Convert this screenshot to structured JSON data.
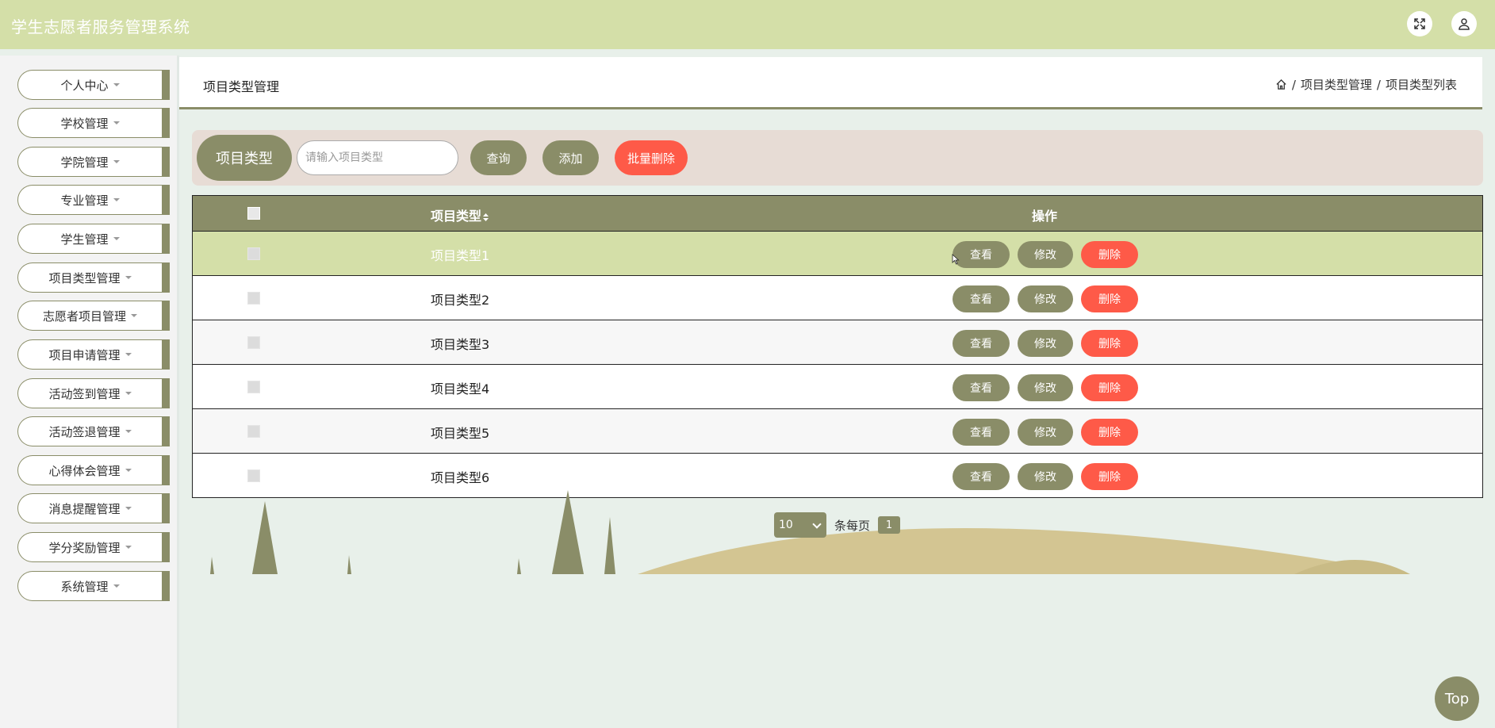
{
  "app": {
    "title": "学生志愿者服务管理系统"
  },
  "header": {
    "fullscreen_icon": "expand-icon",
    "user_icon": "user-icon"
  },
  "sidebar": {
    "items": [
      {
        "label": "个人中心"
      },
      {
        "label": "学校管理"
      },
      {
        "label": "学院管理"
      },
      {
        "label": "专业管理"
      },
      {
        "label": "学生管理"
      },
      {
        "label": "项目类型管理"
      },
      {
        "label": "志愿者项目管理"
      },
      {
        "label": "项目申请管理"
      },
      {
        "label": "活动签到管理"
      },
      {
        "label": "活动签退管理"
      },
      {
        "label": "心得体会管理"
      },
      {
        "label": "消息提醒管理"
      },
      {
        "label": "学分奖励管理"
      },
      {
        "label": "系统管理"
      }
    ]
  },
  "page": {
    "title": "项目类型管理",
    "breadcrumb": [
      "项目类型管理",
      "项目类型列表"
    ]
  },
  "search": {
    "label": "项目类型",
    "placeholder": "请输入项目类型",
    "query_label": "查询",
    "add_label": "添加",
    "batch_delete_label": "批量删除"
  },
  "table": {
    "columns": [
      "项目类型",
      "操作"
    ],
    "rows": [
      {
        "type": "项目类型1"
      },
      {
        "type": "项目类型2"
      },
      {
        "type": "项目类型3"
      },
      {
        "type": "项目类型4"
      },
      {
        "type": "项目类型5"
      },
      {
        "type": "项目类型6"
      }
    ],
    "actions": {
      "view": "查看",
      "edit": "修改",
      "delete": "删除"
    }
  },
  "pagination": {
    "page_size": "10",
    "per_page_label": "条每页",
    "current_page": "1"
  },
  "top_button": "Top",
  "colors": {
    "header": "#d4dfa8",
    "accent": "#8a8d68",
    "danger": "#fe5a48",
    "search_bg": "#e7dcd5"
  }
}
